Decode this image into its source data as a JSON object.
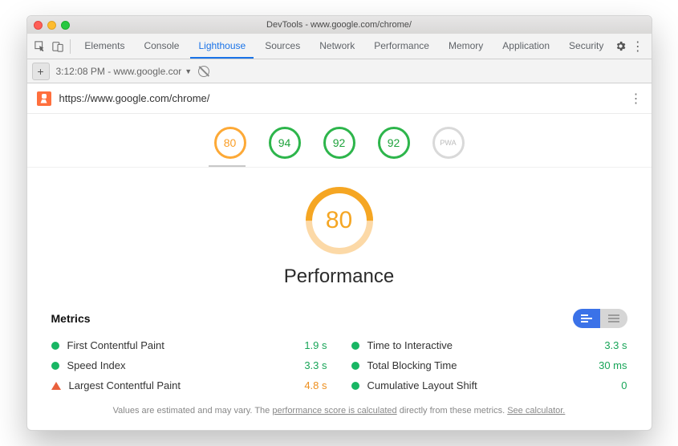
{
  "window": {
    "title": "DevTools - www.google.com/chrome/"
  },
  "tabs": [
    "Elements",
    "Console",
    "Lighthouse",
    "Sources",
    "Network",
    "Performance",
    "Memory",
    "Application",
    "Security"
  ],
  "active_tab": "Lighthouse",
  "row2": {
    "timestamp": "3:12:08 PM - www.google.cor",
    "dropdown_icon": "▼"
  },
  "url": "https://www.google.com/chrome/",
  "gauges": [
    {
      "score": "80",
      "cls": "orange"
    },
    {
      "score": "94",
      "cls": "green"
    },
    {
      "score": "92",
      "cls": "green"
    },
    {
      "score": "92",
      "cls": "green"
    },
    {
      "score": "PWA",
      "cls": "grey"
    }
  ],
  "big_score": "80",
  "big_title": "Performance",
  "metrics_heading": "Metrics",
  "metrics_left": [
    {
      "name": "First Contentful Paint",
      "value": "1.9 s",
      "vcls": "green",
      "status": "green"
    },
    {
      "name": "Speed Index",
      "value": "3.3 s",
      "vcls": "green",
      "status": "green"
    },
    {
      "name": "Largest Contentful Paint",
      "value": "4.8 s",
      "vcls": "orange",
      "status": "tri"
    }
  ],
  "metrics_right": [
    {
      "name": "Time to Interactive",
      "value": "3.3 s",
      "vcls": "green",
      "status": "green"
    },
    {
      "name": "Total Blocking Time",
      "value": "30 ms",
      "vcls": "green",
      "status": "green"
    },
    {
      "name": "Cumulative Layout Shift",
      "value": "0",
      "vcls": "green",
      "status": "green"
    }
  ],
  "footer": {
    "p1": "Values are estimated and may vary. The ",
    "l1": "performance score is calculated",
    "p2": " directly from these metrics. ",
    "l2": "See calculator."
  }
}
